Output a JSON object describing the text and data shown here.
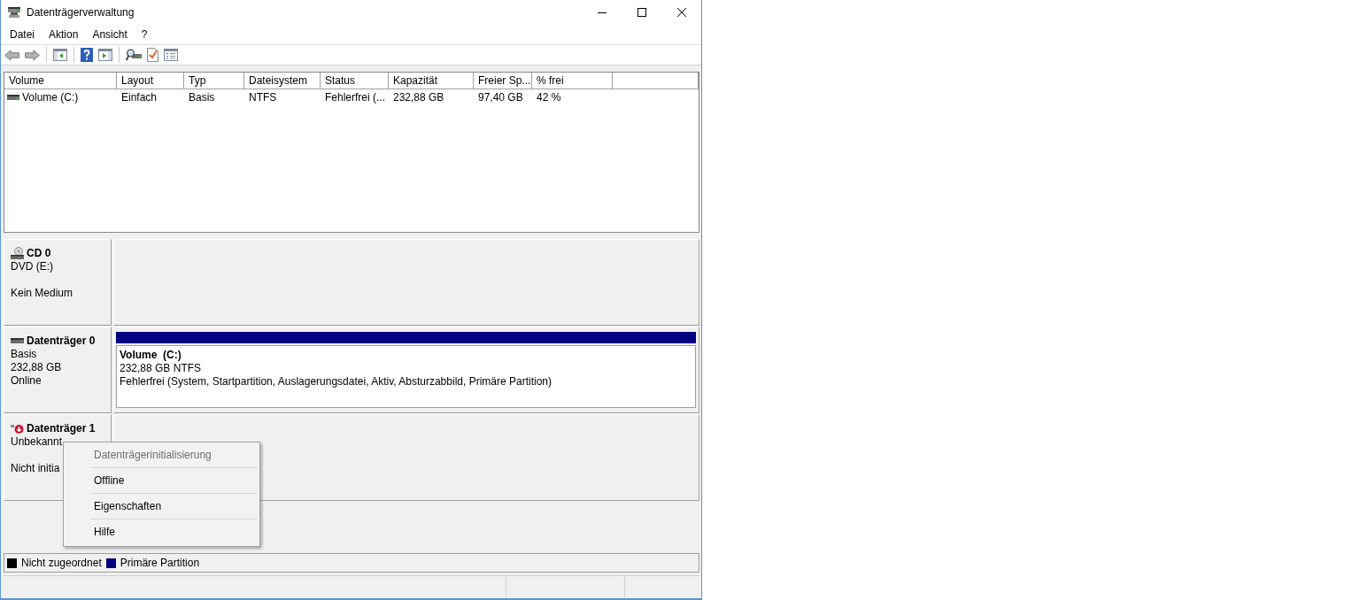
{
  "window": {
    "title": "Datenträgerverwaltung"
  },
  "menu_bar": [
    {
      "label": "Datei"
    },
    {
      "label": "Aktion"
    },
    {
      "label": "Ansicht"
    },
    {
      "label": "?"
    }
  ],
  "volume_list": {
    "columns": [
      "Volume",
      "Layout",
      "Typ",
      "Dateisystem",
      "Status",
      "Kapazität",
      "Freier Sp...",
      "% frei"
    ],
    "rows": [
      {
        "selected": false,
        "cells": [
          "Volume (C:)",
          "Einfach",
          "Basis",
          "NTFS",
          "Fehlerfrei (...",
          "232,88 GB",
          "97,40 GB",
          "42 %"
        ]
      }
    ]
  },
  "disks": [
    {
      "kind": "cd",
      "error": false,
      "name": "CD 0",
      "type": "DVD (E:)",
      "status": "Kein Medium"
    },
    {
      "kind": "disk",
      "error": false,
      "name": "Datenträger 0",
      "type": "Basis",
      "size": "232,88 GB",
      "status": "Online",
      "partitions": [
        {
          "color": "#000080",
          "name": "Volume  (C:)",
          "size": "232,88 GB NTFS",
          "status": "Fehlerfrei (System, Startpartition, Auslagerungsdatei, Aktiv, Absturzabbild, Primäre Partition)"
        }
      ]
    },
    {
      "kind": "disk",
      "error": true,
      "name": "Datenträger 1",
      "type": "Unbekannt",
      "status": "Nicht initia"
    }
  ],
  "legend": [
    {
      "label": "Nicht zugeordnet",
      "color": "#000000"
    },
    {
      "label": "Primäre Partition",
      "color": "#000080"
    }
  ],
  "context_menu": {
    "items": [
      {
        "label": "Datenträgerinitialisierung",
        "disabled": true
      },
      {
        "label": "Offline",
        "disabled": false
      },
      {
        "label": "Eigenschaften",
        "disabled": false
      },
      {
        "label": "Hilfe",
        "disabled": false
      }
    ]
  }
}
